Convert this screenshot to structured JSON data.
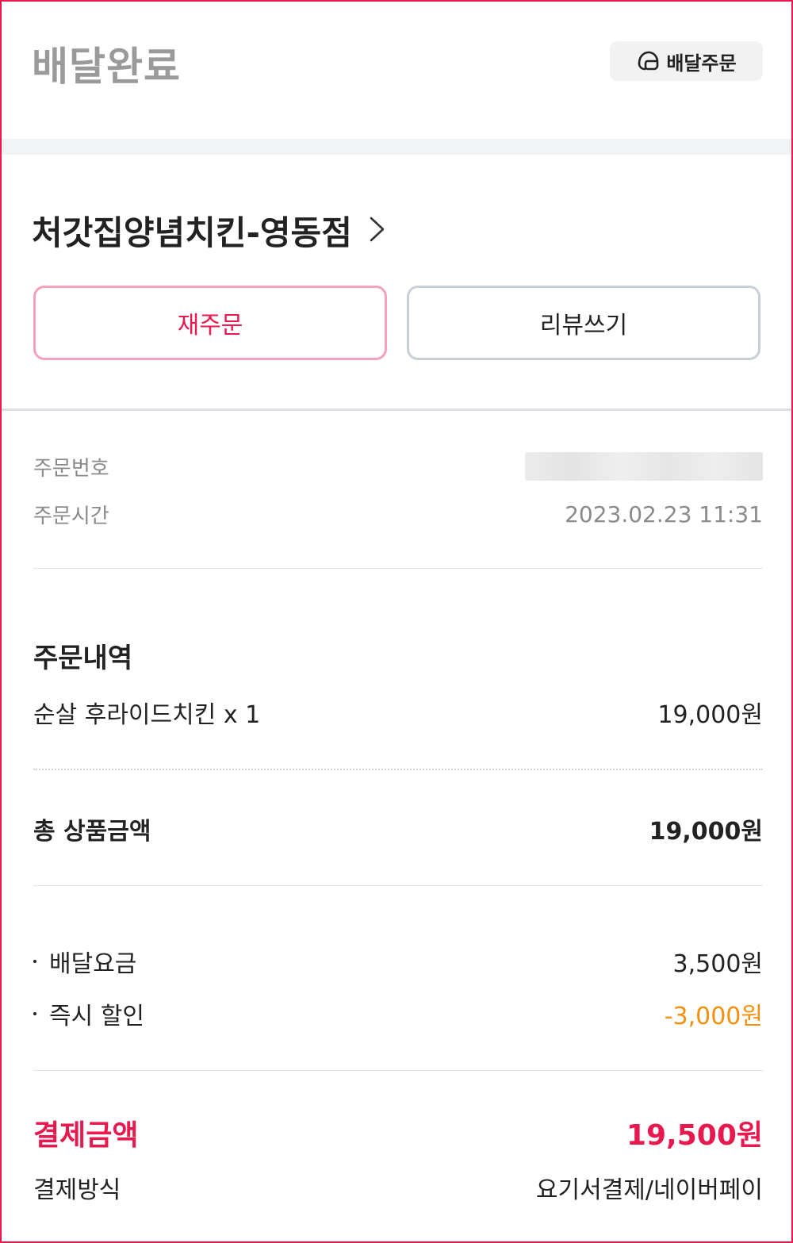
{
  "header": {
    "status_title": "배달완료",
    "order_type_chip": {
      "label": "배달주문",
      "icon": "helmet-icon"
    }
  },
  "store": {
    "name": "처갓집양념치킨-영동점",
    "arrow_icon": "chevron-right-icon"
  },
  "actions": {
    "reorder_label": "재주문",
    "review_label": "리뷰쓰기"
  },
  "order_info": {
    "order_number_label": "주문번호",
    "order_time_label": "주문시간",
    "order_time_value": "2023.02.23 11:31"
  },
  "order_details": {
    "title": "주문내역",
    "items": [
      {
        "name": "순살 후라이드치킨 x 1",
        "price": "19,000원"
      }
    ],
    "subtotal_label": "총 상품금액",
    "subtotal_value": "19,000원"
  },
  "fees": {
    "delivery_fee_label": "배달요금",
    "delivery_fee_value": "3,500원",
    "instant_discount_label": "즉시 할인",
    "instant_discount_value": "-3,000원"
  },
  "payment": {
    "total_label": "결제금액",
    "total_value": "19,500원",
    "method_label": "결제방식",
    "method_value": "요기서결제/네이버페이"
  },
  "colors": {
    "accent": "#e8194f",
    "discount": "#f5900f",
    "title_gray": "#9a9a9a",
    "frame_border": "#e8194f"
  }
}
